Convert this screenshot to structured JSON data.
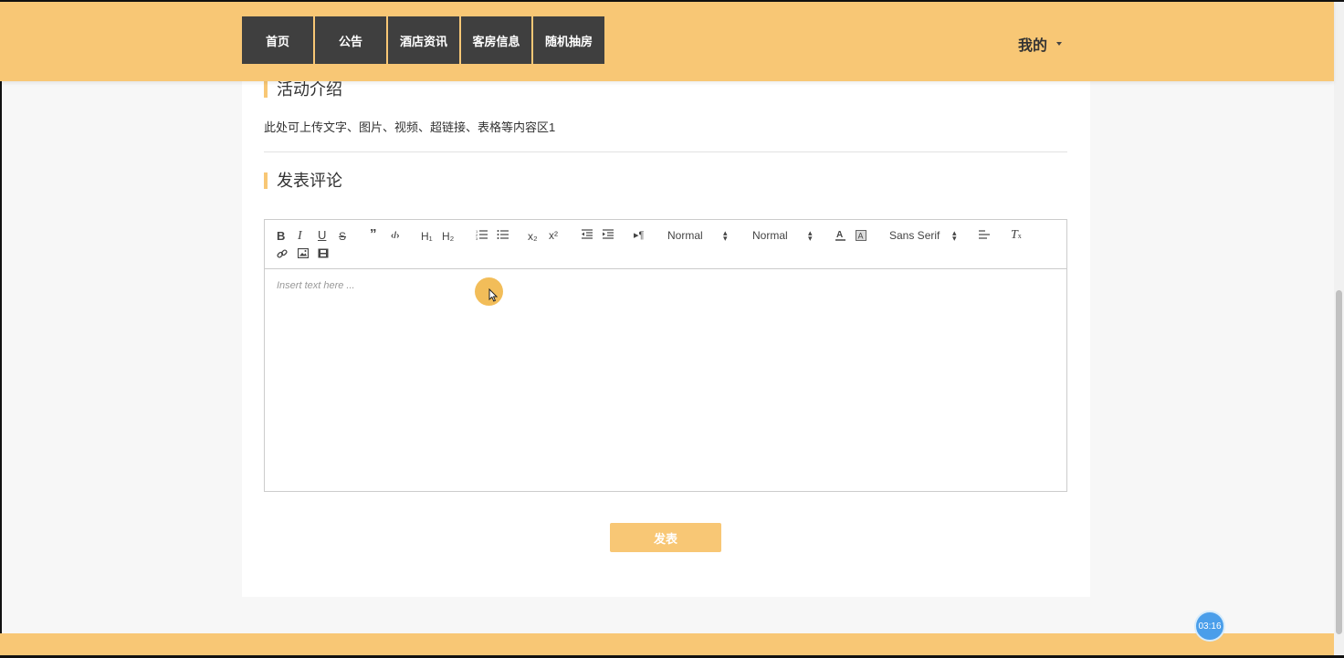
{
  "nav": {
    "items": [
      "首页",
      "公告",
      "酒店资讯",
      "客房信息",
      "随机抽房"
    ],
    "user_menu": "我的"
  },
  "activity": {
    "title": "活动介绍",
    "content": "此处可上传文字、图片、视频、超链接、表格等内容区1"
  },
  "comment": {
    "title": "发表评论",
    "editor": {
      "toolbar": {
        "header_select": "Normal",
        "size_select": "Normal",
        "font_select": "Sans Serif"
      },
      "placeholder": "Insert text here ..."
    },
    "submit_label": "发表"
  },
  "recorder": {
    "timer": "03:16"
  },
  "colors": {
    "accent": "#f8c775",
    "nav_bg": "#3f3f3f"
  }
}
